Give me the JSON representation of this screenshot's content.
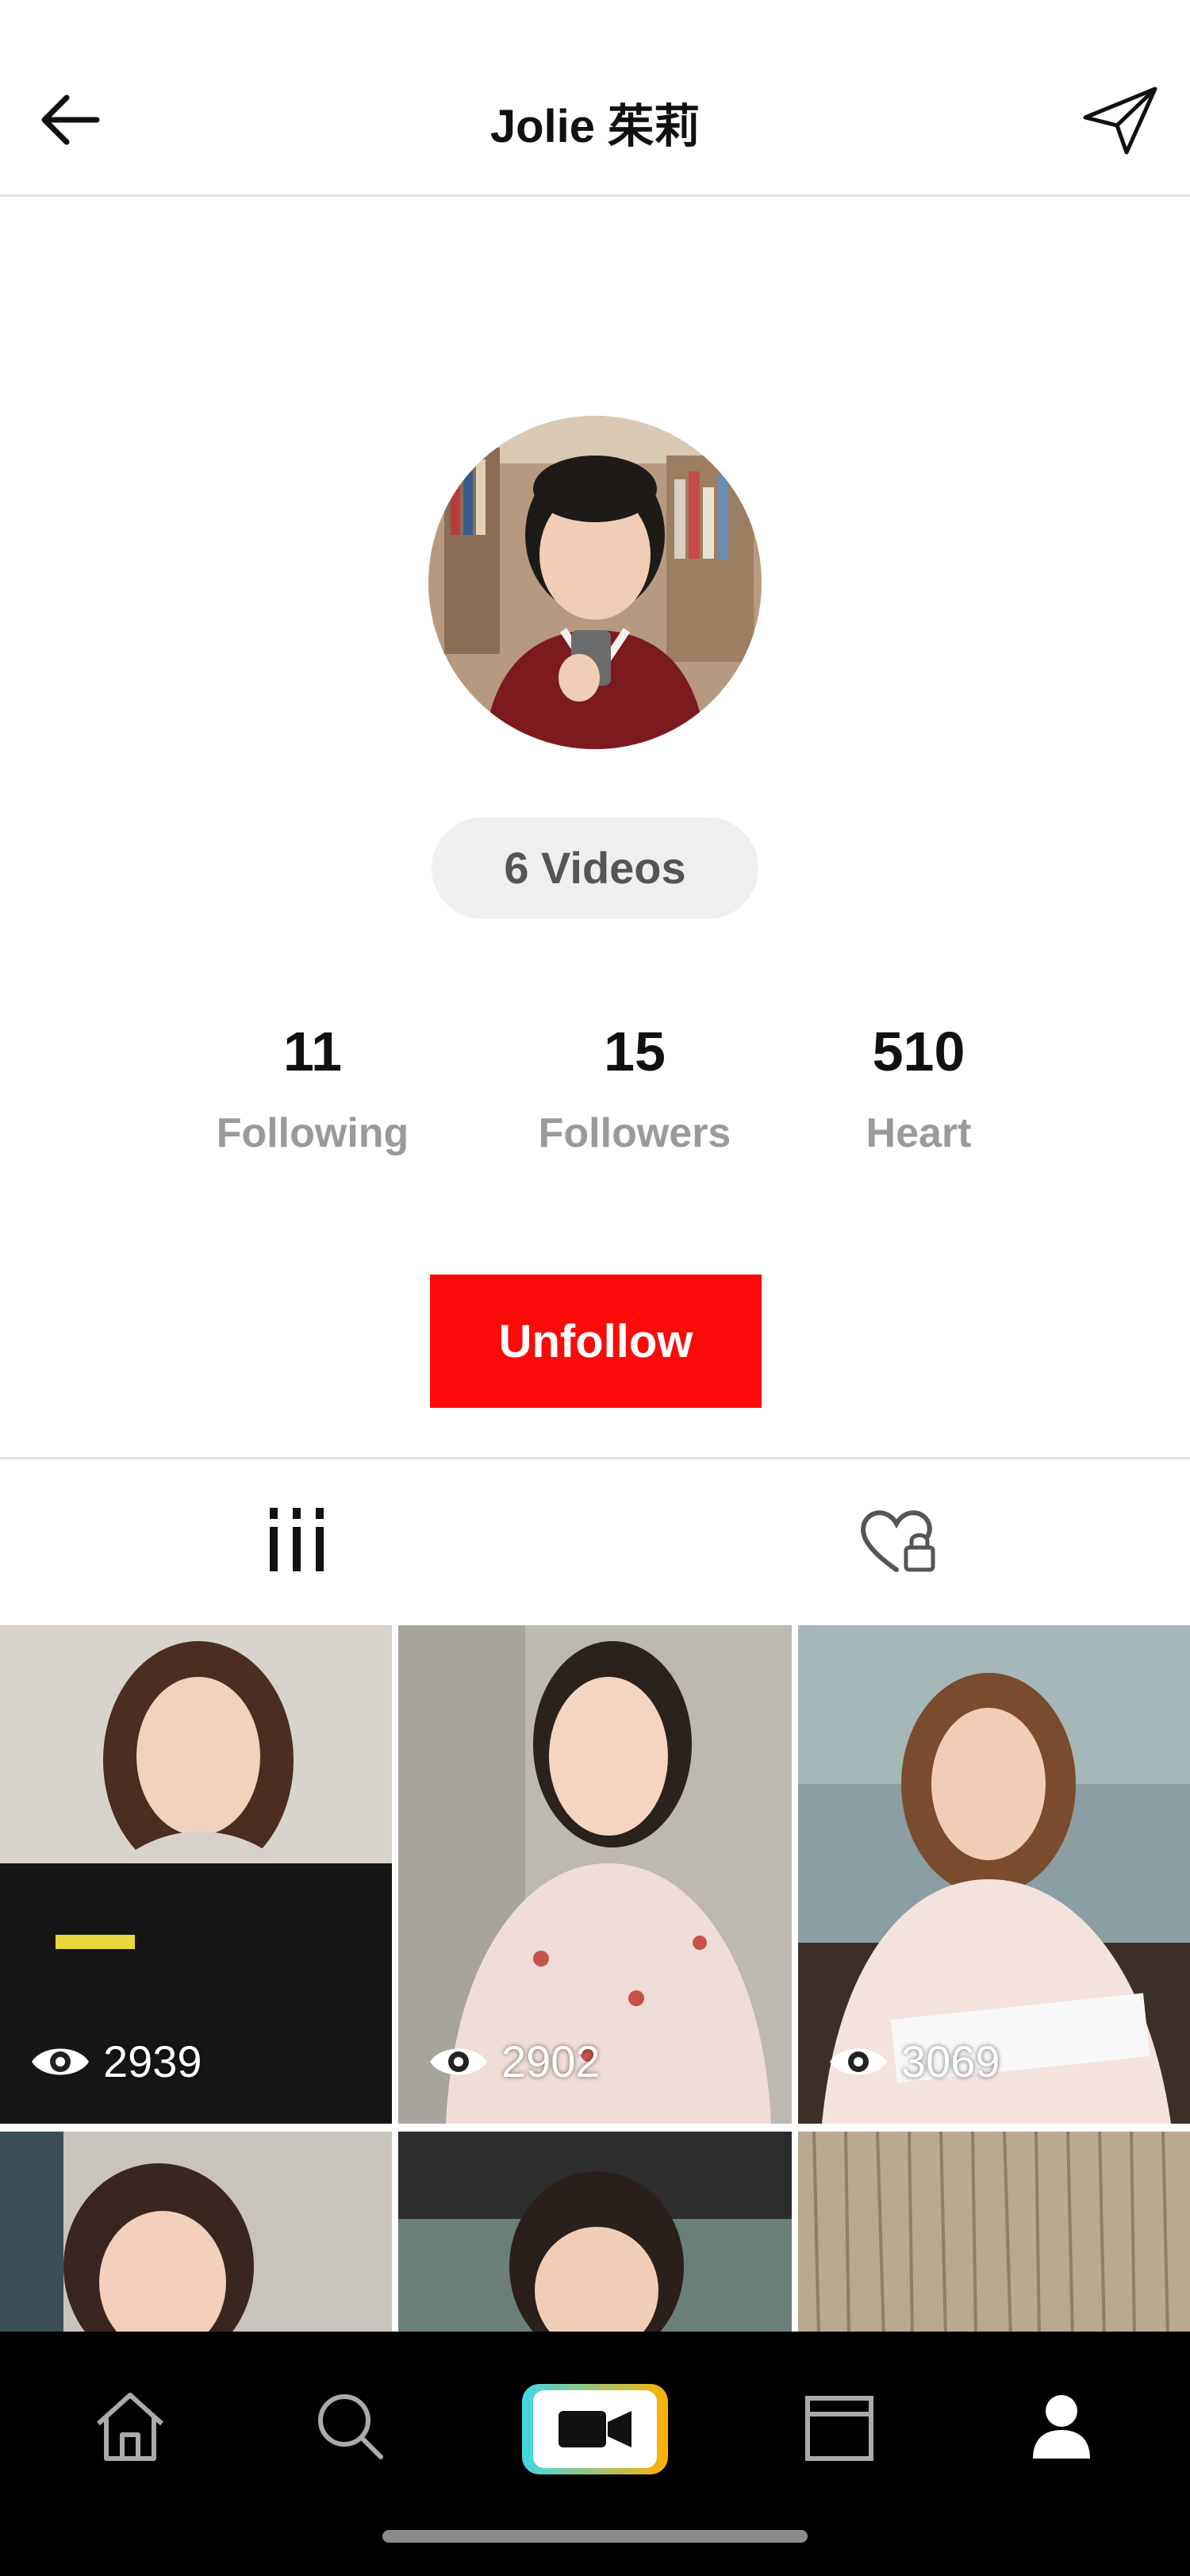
{
  "header": {
    "title": "Jolie 茱莉"
  },
  "profile": {
    "videos_label": "6 Videos",
    "stats": [
      {
        "value": "11",
        "label": "Following"
      },
      {
        "value": "15",
        "label": "Followers"
      },
      {
        "value": "510",
        "label": "Heart"
      }
    ],
    "unfollow_label": "Unfollow"
  },
  "tabs": [
    {
      "icon": "grid-icon",
      "active": true
    },
    {
      "icon": "heart-lock-icon",
      "active": false
    }
  ],
  "videos": [
    {
      "views": "2939"
    },
    {
      "views": "2902"
    },
    {
      "views": "3069"
    },
    {
      "views": ""
    },
    {
      "views": ""
    },
    {
      "views": ""
    }
  ],
  "bottom_nav": [
    {
      "icon": "home-icon"
    },
    {
      "icon": "search-icon"
    },
    {
      "icon": "video-camera-icon"
    },
    {
      "icon": "calendar-icon"
    },
    {
      "icon": "profile-icon"
    }
  ],
  "colors": {
    "accent": "#fc0a0a",
    "nav_background": "#000000",
    "camera_gradient_left": "#3fd8e8",
    "camera_gradient_right": "#ffb000"
  }
}
